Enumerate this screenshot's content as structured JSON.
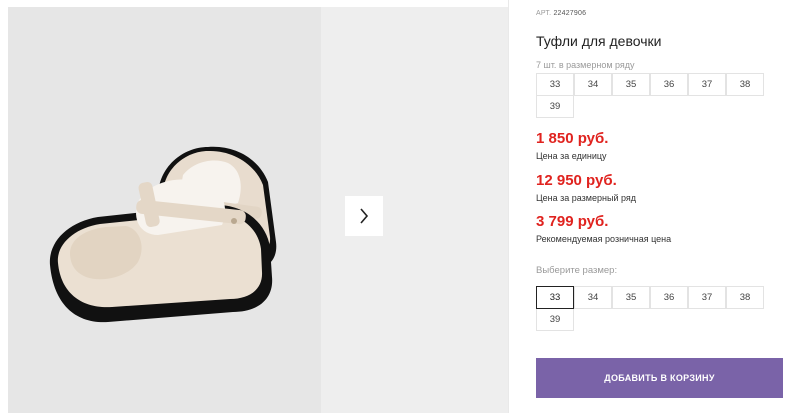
{
  "product": {
    "sku_label": "АРТ.",
    "sku": "22427906",
    "title": "Туфли для девочки"
  },
  "pack": {
    "label": "7 шт. в размерном ряду",
    "sizes": [
      "33",
      "34",
      "35",
      "36",
      "37",
      "38",
      "39"
    ]
  },
  "prices": {
    "unit_price": "1 850 руб.",
    "unit_note": "Цена за единицу",
    "pack_price": "12 950 руб.",
    "pack_note": "Цена за размерный ряд",
    "retail_price": "3 799 руб.",
    "retail_note": "Рекомендуемая розничная цена"
  },
  "size_select": {
    "label": "Выберите размер:",
    "sizes": [
      "33",
      "34",
      "35",
      "36",
      "37",
      "38",
      "39"
    ],
    "selected": "33"
  },
  "cart_button": "ДОБАВИТЬ В КОРЗИНУ",
  "colors": {
    "price_red": "#e0231f",
    "button_purple": "#7a63a8"
  },
  "icons": {
    "next_arrow": "chevron-right-icon"
  }
}
